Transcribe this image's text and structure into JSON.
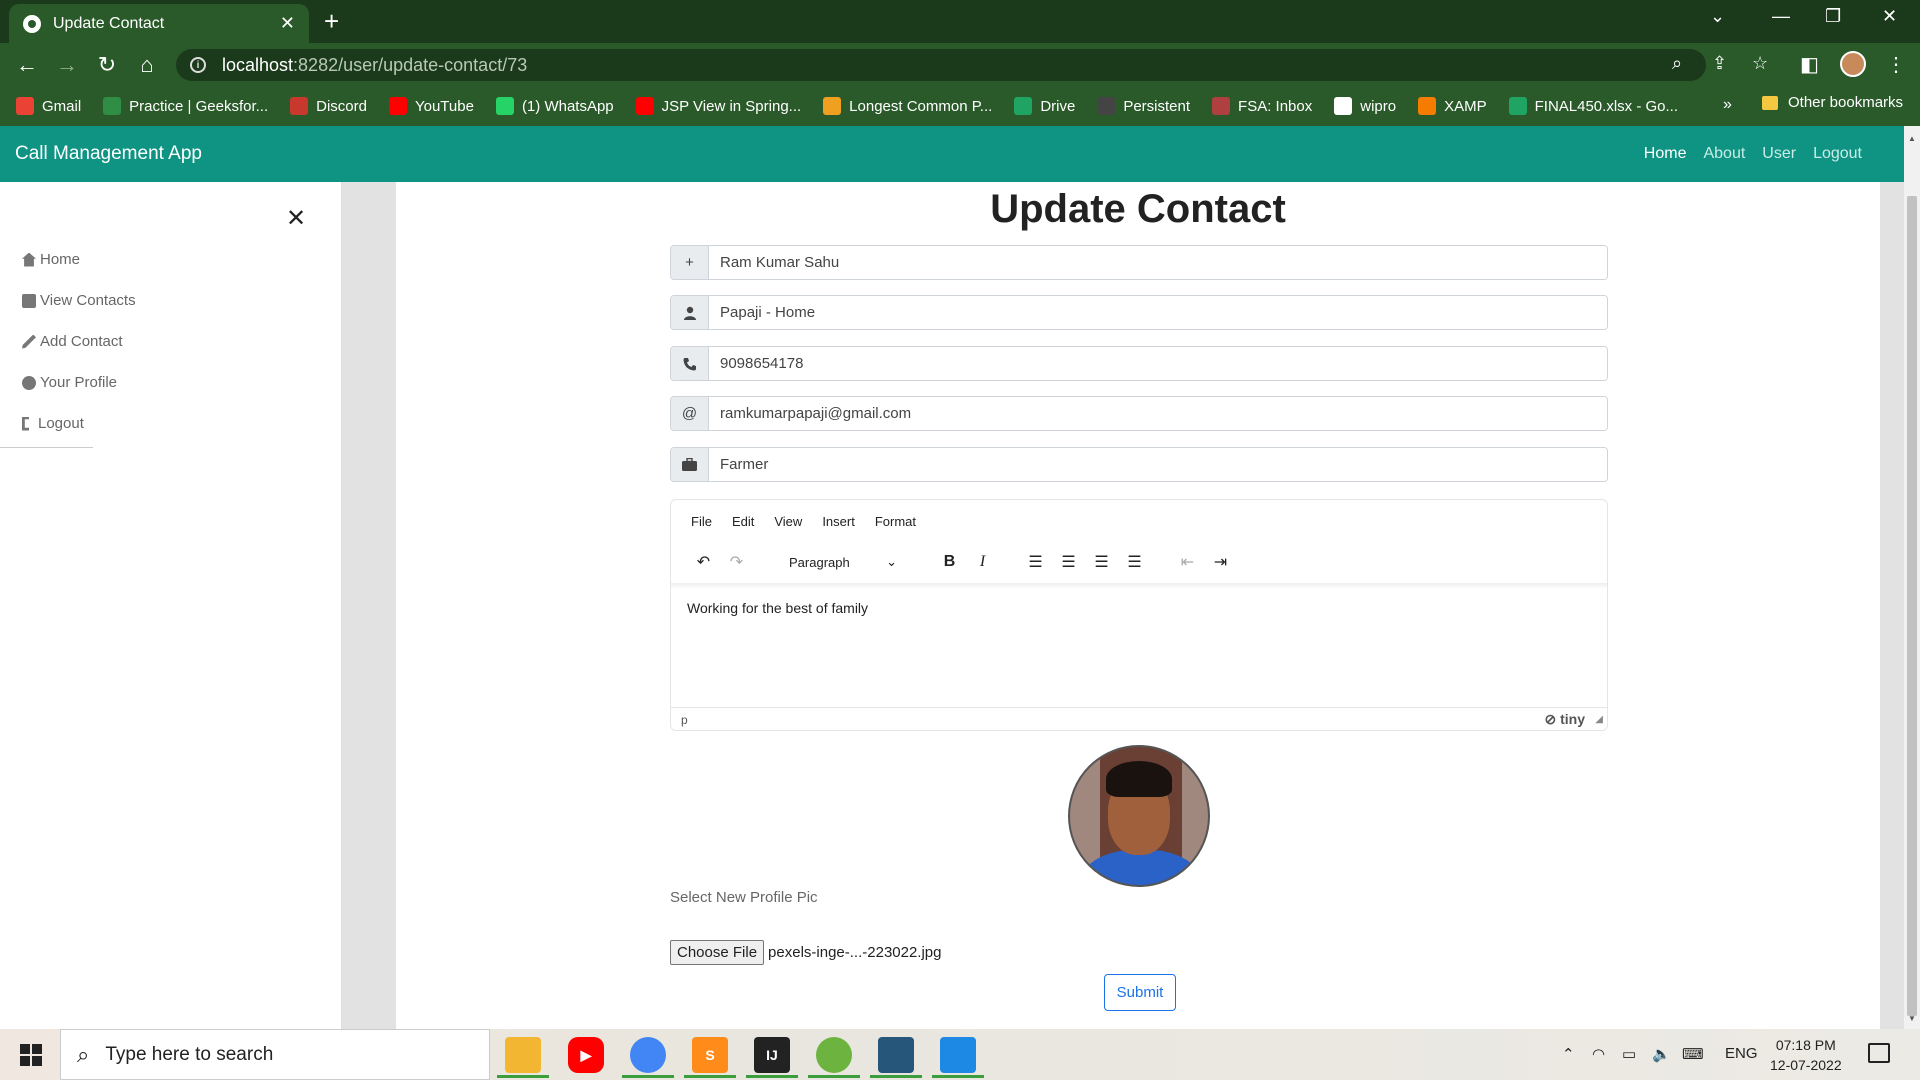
{
  "browser": {
    "tab_title": "Update Contact",
    "url_host": "localhost",
    "url_path": ":8282/user/update-contact/73",
    "bookmarks": [
      {
        "label": "Gmail",
        "color": "#ea4335"
      },
      {
        "label": "Practice | Geeksfor...",
        "color": "#2f8d46"
      },
      {
        "label": "Discord",
        "color": "#c8382d"
      },
      {
        "label": "YouTube",
        "color": "#ff0000"
      },
      {
        "label": "(1) WhatsApp",
        "color": "#25d366"
      },
      {
        "label": "JSP View in Spring...",
        "color": "#ff0000"
      },
      {
        "label": "Longest Common P...",
        "color": "#f0a020"
      },
      {
        "label": "Drive",
        "color": "#1fa463"
      },
      {
        "label": "Persistent",
        "color": "#444444"
      },
      {
        "label": "FSA: Inbox",
        "color": "#b04040"
      },
      {
        "label": "wipro",
        "color": "#ffffff"
      },
      {
        "label": "XAMP",
        "color": "#f57c00"
      },
      {
        "label": "FINAL450.xlsx - Go...",
        "color": "#1fa463"
      }
    ],
    "more_bookmarks": "»",
    "other_bookmarks": "Other bookmarks"
  },
  "app": {
    "brand": "Call Management App",
    "nav": [
      "Home",
      "About",
      "User",
      "Logout"
    ],
    "active_nav": "Home",
    "accent_color": "#0f9484"
  },
  "sidebar": {
    "items": [
      {
        "label": "Home",
        "icon": "home-icon"
      },
      {
        "label": "View Contacts",
        "icon": "contacts-icon"
      },
      {
        "label": "Add Contact",
        "icon": "pencil-icon"
      },
      {
        "label": "Your Profile",
        "icon": "user-circle-icon"
      },
      {
        "label": "Logout",
        "icon": "sign-out-icon"
      }
    ]
  },
  "form": {
    "title": "Update Contact",
    "name": "Ram Kumar Sahu",
    "nickname": "Papaji - Home",
    "phone": "9098654178",
    "email": "ramkumarpapaji@gmail.com",
    "work": "Farmer",
    "addon_symbols": {
      "name": "+",
      "email": "@"
    },
    "editor": {
      "menu": [
        "File",
        "Edit",
        "View",
        "Insert",
        "Format"
      ],
      "block_format": "Paragraph",
      "content": "Working for the best of family",
      "status_path": "p",
      "brand": "tiny"
    },
    "pic_label": "Select New Profile Pic",
    "file_button": "Choose File",
    "file_name": "pexels-inge-...-223022.jpg",
    "submit": "Submit"
  },
  "taskbar": {
    "search_placeholder": "Type here to search",
    "language": "ENG",
    "time": "07:18 PM",
    "date": "12-07-2022"
  }
}
